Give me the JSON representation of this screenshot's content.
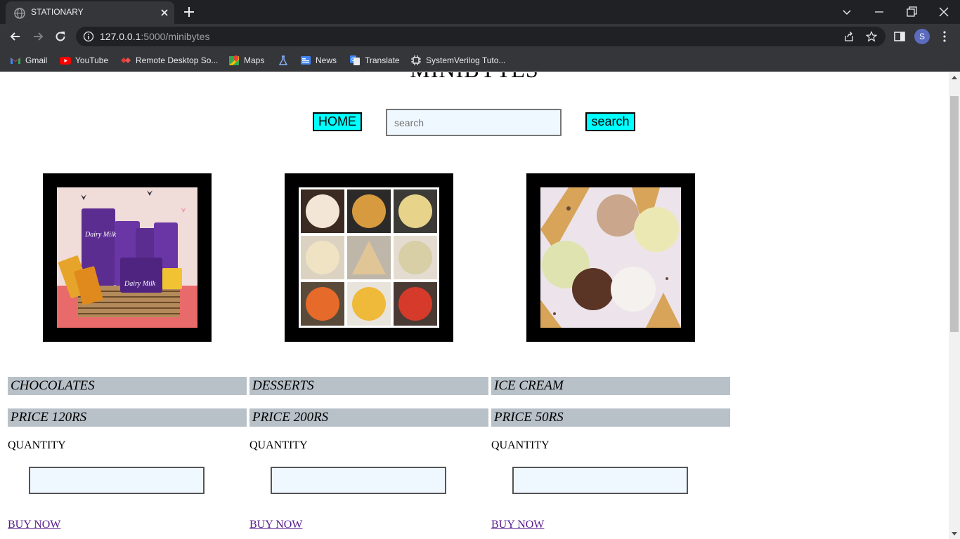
{
  "browser": {
    "tab_title": "STATIONARY",
    "url_host": "127.0.0.1",
    "url_rest": ":5000/minibytes",
    "profile_initial": "S",
    "bookmarks": [
      {
        "label": "Gmail",
        "icon": "gmail-icon"
      },
      {
        "label": "YouTube",
        "icon": "youtube-icon"
      },
      {
        "label": "Remote Desktop So...",
        "icon": "remote-desktop-icon"
      },
      {
        "label": "Maps",
        "icon": "maps-icon"
      },
      {
        "label": "",
        "icon": "flask-icon"
      },
      {
        "label": "News",
        "icon": "news-icon"
      },
      {
        "label": "Translate",
        "icon": "translate-icon"
      },
      {
        "label": "SystemVerilog Tuto...",
        "icon": "chip-icon"
      }
    ]
  },
  "page": {
    "title": "MINIBYTES",
    "home_label": "HOME",
    "search_placeholder": "search",
    "search_button_label": "search",
    "products": [
      {
        "name": "CHOCOLATES",
        "price": "PRICE 120RS",
        "quantity_label": "QUANTITY",
        "buy_label": "BUY NOW",
        "image": "chocolates-image"
      },
      {
        "name": "DESSERTS",
        "price": "PRICE 200RS",
        "quantity_label": "QUANTITY",
        "buy_label": "BUY NOW",
        "image": "desserts-image"
      },
      {
        "name": "ICE CREAM",
        "price": "PRICE 50RS",
        "quantity_label": "QUANTITY",
        "buy_label": "BUY NOW",
        "image": "ice-cream-image"
      }
    ]
  },
  "colors": {
    "chrome_dark": "#202124",
    "chrome_toolbar": "#35363a",
    "button_cyan": "#00ffff",
    "label_bar": "#b8c0c8",
    "input_bg": "#f0f8ff",
    "visited_link": "#551a8b"
  }
}
